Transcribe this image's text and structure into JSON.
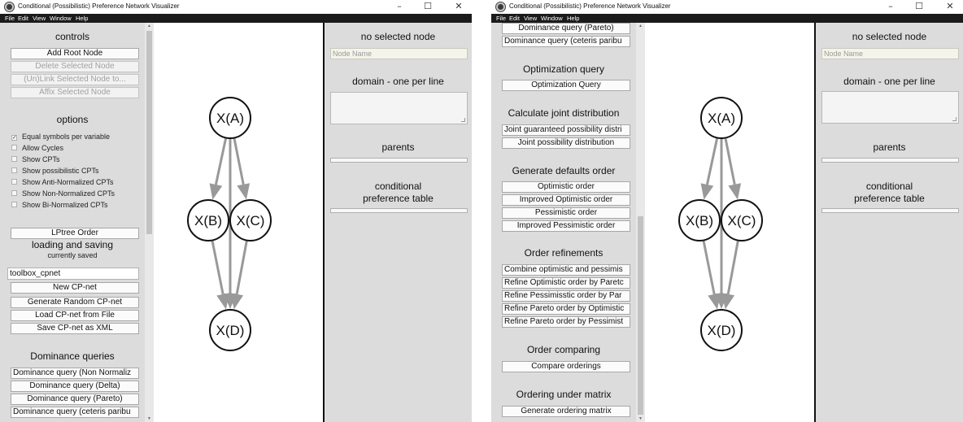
{
  "app": {
    "title": "Conditional (Possibilistic) Preference Network Visualizer",
    "menu": [
      "File",
      "Edit",
      "View",
      "Window",
      "Help"
    ],
    "window_controls": {
      "minimize": "–",
      "maximize": "☐",
      "close": "✕"
    }
  },
  "window1": {
    "controls_heading": "controls",
    "control_buttons": [
      {
        "label": "Add Root Node",
        "enabled": true
      },
      {
        "label": "Delete Selected Node",
        "enabled": false
      },
      {
        "label": "(Un)Link Selected Node to...",
        "enabled": false
      },
      {
        "label": "Affix Selected Node",
        "enabled": false
      }
    ],
    "options_heading": "options",
    "options": [
      {
        "label": "Equal symbols per variable",
        "checked": true
      },
      {
        "label": "Allow Cycles",
        "checked": false
      },
      {
        "label": "Show CPTs",
        "checked": false
      },
      {
        "label": "Show possibilistic CPTs",
        "checked": false
      },
      {
        "label": "Show Anti-Normalized CPTs",
        "checked": false
      },
      {
        "label": "Show Non-Normalized CPTs",
        "checked": false
      },
      {
        "label": "Show Bi-Normalized CPTs",
        "checked": false
      }
    ],
    "lptree_button": "LPtree Order",
    "loading_heading": "loading and saving",
    "loading_status": "currently saved",
    "filename_value": "toolbox_cpnet",
    "file_buttons": [
      "New CP-net",
      "Generate Random CP-net",
      "Load CP-net from File",
      "Save CP-net as XML"
    ],
    "dominance_heading": "Dominance queries",
    "dominance_buttons": [
      "Dominance query (Non Normaliz",
      "Dominance query (Delta)",
      "Dominance query (Pareto)",
      "Dominance query (ceteris paribu"
    ]
  },
  "window2": {
    "top_buttons": [
      "Dominance query (Pareto)",
      "Dominance query (ceteris paribu"
    ],
    "optimization_heading": "Optimization query",
    "optimization_button": "Optimization Query",
    "joint_heading": "Calculate joint distribution",
    "joint_buttons": [
      "Joint guaranteed possibility distri",
      "Joint possibility distribution"
    ],
    "defaults_heading": "Generate defaults order",
    "defaults_buttons": [
      "Optimistic order",
      "Improved Optimistic order",
      "Pessimistic order",
      "Improved Pessimistic order"
    ],
    "refinements_heading": "Order refinements",
    "refinement_buttons": [
      "Combine optimistic and pessimis",
      "Refine Optimistic order by Paretc",
      "Refine Pessimisstic order by Par",
      "Refine Pareto order by Optimistic",
      "Refine Pareto order by Pessimist"
    ],
    "comparing_heading": "Order comparing",
    "comparing_button": "Compare orderings",
    "matrix_heading": "Ordering under matrix",
    "matrix_button": "Generate ordering matrix"
  },
  "node_panel": {
    "heading": "no selected node",
    "name_placeholder": "Node Name",
    "domain_label": "domain - one per line",
    "parents_label": "parents",
    "cpt_label_line1": "conditional",
    "cpt_label_line2": "preference table"
  },
  "graph": {
    "nodes": [
      "X(A)",
      "X(B)",
      "X(C)",
      "X(D)"
    ],
    "edges": [
      [
        "X(A)",
        "X(B)"
      ],
      [
        "X(A)",
        "X(C)"
      ],
      [
        "X(A)",
        "X(D)"
      ],
      [
        "X(B)",
        "X(D)"
      ],
      [
        "X(C)",
        "X(D)"
      ]
    ],
    "edge_color": "#999999"
  }
}
